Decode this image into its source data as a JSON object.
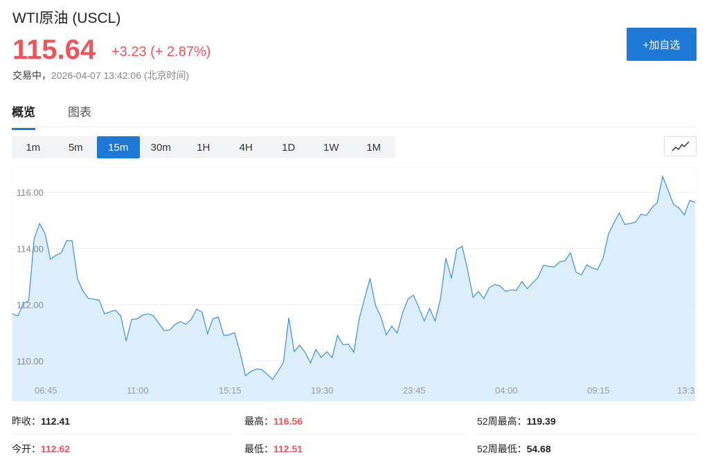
{
  "header": {
    "title": "WTI原油  (USCL)",
    "price": "115.64",
    "change": "+3.23 (+ 2.87%)",
    "status": "交易中，",
    "timestamp": "2026-04-07 13:42:06 (北京时间)",
    "add_button": "+加自选"
  },
  "tabs": [
    {
      "label": "概览",
      "active": true
    },
    {
      "label": "图表",
      "active": false
    }
  ],
  "intervals": [
    "1m",
    "5m",
    "15m",
    "30m",
    "1H",
    "4H",
    "1D",
    "1W",
    "1M"
  ],
  "selected_interval": "15m",
  "colors": {
    "accent": "#1d78d6",
    "up": "#f0535a",
    "line": "#3a8ee6",
    "fill": "#ddeefd"
  },
  "chart_data": {
    "type": "area",
    "yticks": [
      "110.00",
      "112.00",
      "114.00",
      "116.00"
    ],
    "ylim": [
      108.57,
      116.89
    ],
    "xticks": [
      "06:45",
      "11:00",
      "15:15",
      "19:30",
      "23:45",
      "04:00",
      "09:15",
      "13:3"
    ],
    "values": [
      111.68,
      111.6,
      112.04,
      112.16,
      114.35,
      114.89,
      114.54,
      113.62,
      113.76,
      113.85,
      114.28,
      114.28,
      112.93,
      112.49,
      112.23,
      112.2,
      112.16,
      111.68,
      111.75,
      111.81,
      111.59,
      110.71,
      111.48,
      111.5,
      111.63,
      111.68,
      111.61,
      111.34,
      111.08,
      111.1,
      111.3,
      111.4,
      111.31,
      111.48,
      111.85,
      111.73,
      110.97,
      111.5,
      111.56,
      110.91,
      110.93,
      111.01,
      110.3,
      109.47,
      109.63,
      109.71,
      109.7,
      109.53,
      109.34,
      109.63,
      109.94,
      111.54,
      110.33,
      110.56,
      110.31,
      109.93,
      110.41,
      110.12,
      110.33,
      110.12,
      110.91,
      110.58,
      110.6,
      110.31,
      111.5,
      112.24,
      112.94,
      111.98,
      111.57,
      110.93,
      111.24,
      110.99,
      111.71,
      112.2,
      112.34,
      111.91,
      111.42,
      111.87,
      111.42,
      112.22,
      113.66,
      112.94,
      113.97,
      114.08,
      113.25,
      112.27,
      112.47,
      112.22,
      112.61,
      112.72,
      112.67,
      112.48,
      112.53,
      112.51,
      112.83,
      112.57,
      112.78,
      112.97,
      113.41,
      113.37,
      113.34,
      113.53,
      113.57,
      113.85,
      113.17,
      113.06,
      113.42,
      113.31,
      113.25,
      113.66,
      114.52,
      114.91,
      115.27,
      114.86,
      114.89,
      114.94,
      115.22,
      115.18,
      115.45,
      115.64,
      116.57,
      116.08,
      115.57,
      115.45,
      115.2,
      115.71,
      115.65
    ]
  },
  "stats": {
    "prev_close_label": "昨收：",
    "prev_close": "112.41",
    "high_label": "最高：",
    "high": "116.56",
    "high52_label": "52周最高：",
    "high52": "119.39",
    "open_label": "今开：",
    "open": "112.62",
    "low_label": "最低：",
    "low": "112.51",
    "low52_label": "52周最低：",
    "low52": "54.68"
  }
}
